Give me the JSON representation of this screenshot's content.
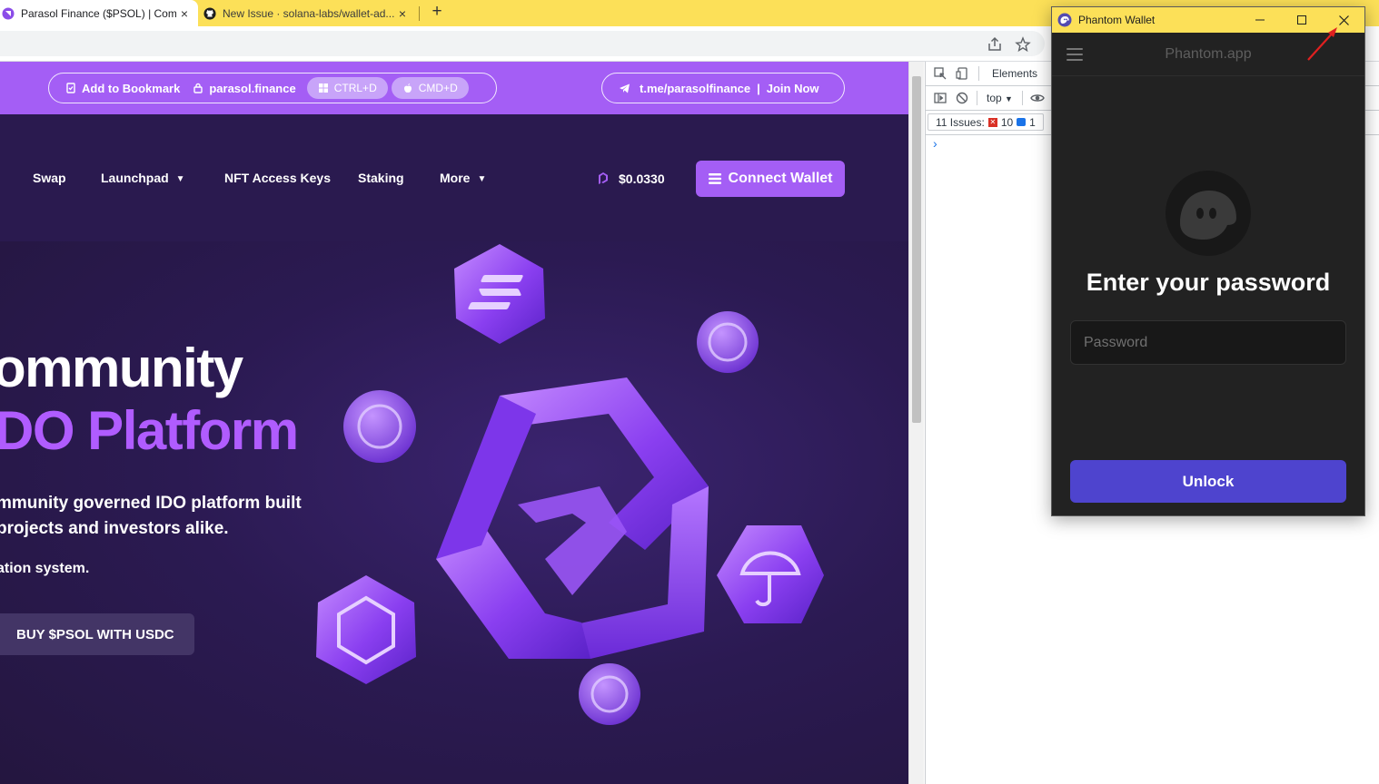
{
  "browser": {
    "tabs": [
      {
        "title": "Parasol Finance ($PSOL) | Comm...",
        "active": true,
        "close": "×"
      },
      {
        "title": "New Issue · solana-labs/wallet-ad...",
        "active": false,
        "close": "×"
      }
    ],
    "new_tab": "+"
  },
  "site": {
    "banner": {
      "bookmark_label": "Add to Bookmark",
      "domain_label": "parasol.finance",
      "shortcut_windows": "CTRL+D",
      "shortcut_mac": "CMD+D",
      "telegram_label": "t.me/parasolfinance",
      "join_label": "Join Now"
    },
    "nav": {
      "items": [
        {
          "label": "Swap"
        },
        {
          "label": "Launchpad",
          "chevron": "⌄"
        },
        {
          "label": "NFT Access Keys"
        },
        {
          "label": "Staking"
        },
        {
          "label": "More",
          "chevron": "⌄"
        }
      ],
      "price": "$0.0330",
      "connect_label": "Connect Wallet"
    },
    "hero": {
      "title_line1": "ommunity",
      "title_line2": "DO Platform",
      "desc_line1": "mmunity governed IDO platform built",
      "desc_line2": "projects and investors alike.",
      "desc_line3": "ation system.",
      "buy_label": "BUY $PSOL WITH USDC"
    }
  },
  "devtools": {
    "tab_elements": "Elements",
    "context": "top",
    "issues_label": "11 Issues:",
    "errors_count": "10",
    "info_count": "1",
    "prompt": "›"
  },
  "phantom": {
    "window_title": "Phantom Wallet",
    "brand": "Phantom.app",
    "heading": "Enter your password",
    "password_placeholder": "Password",
    "unlock_label": "Unlock"
  },
  "colors": {
    "tabstrip": "#fce058",
    "banner": "#a45ef5",
    "hero_bg": "#2a1a4f",
    "accent_purple": "#b05cff",
    "phantom_bg": "#222222",
    "unlock_button": "#4e44ce",
    "annotation_arrow": "#e02020"
  }
}
